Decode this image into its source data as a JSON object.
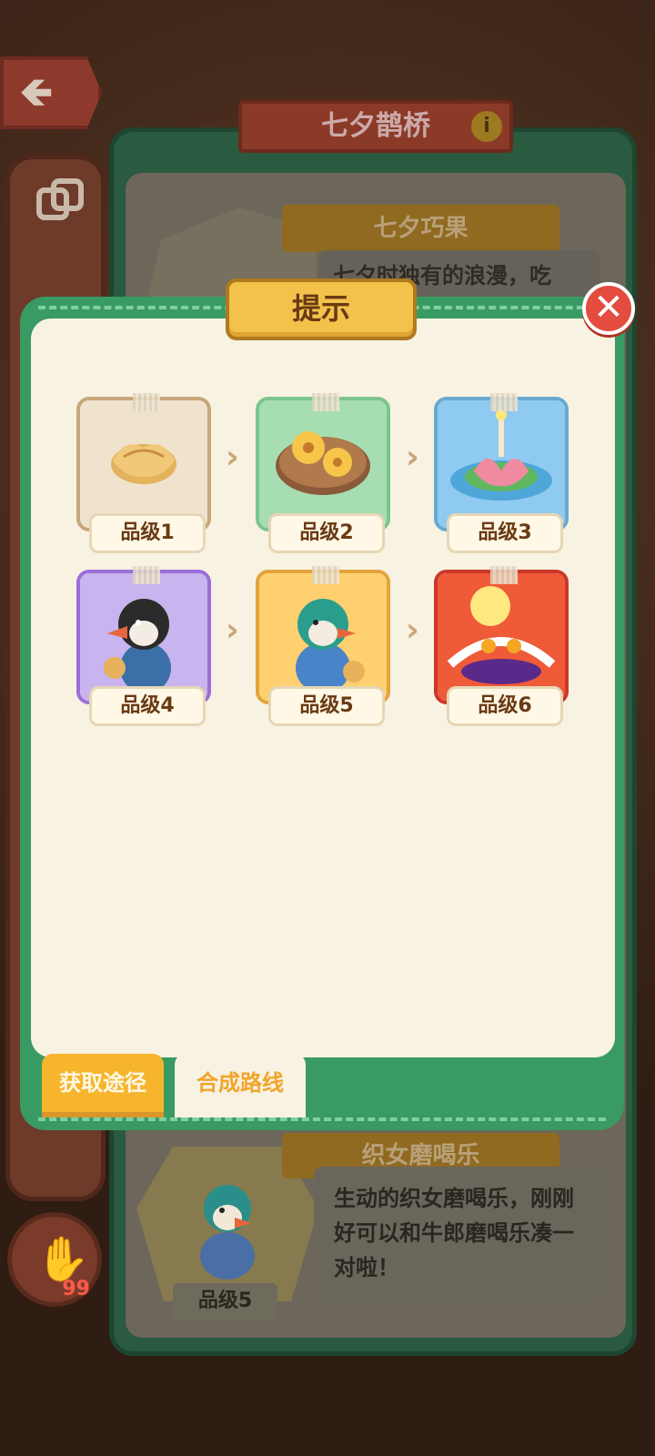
{
  "background": {
    "back_arrow": "🡸",
    "title": "七夕鹊桥",
    "info_icon": "i",
    "top_item_name": "七夕巧果",
    "top_item_desc": "七夕时独有的浪漫，吃",
    "bottom_item_name": "织女磨喝乐",
    "bottom_item_desc": "生动的织女磨喝乐，刚刚好可以和牛郎磨喝乐凑一对啦！",
    "bottom_item_grade": "品级5",
    "hand_count": "99"
  },
  "modal": {
    "title": "提示",
    "close_icon": "✕",
    "tiers": [
      {
        "label": "品级1",
        "bg": "#f0e3cd",
        "border": "#c6a67a"
      },
      {
        "label": "品级2",
        "bg": "#a6deb2",
        "border": "#7bc58e"
      },
      {
        "label": "品级3",
        "bg": "#8fcaf0",
        "border": "#6aa9cf"
      },
      {
        "label": "品级4",
        "bg": "#c8b4ee",
        "border": "#9a6fd8"
      },
      {
        "label": "品级5",
        "bg": "#ffd070",
        "border": "#e3a43a"
      },
      {
        "label": "品级6",
        "bg": "#ef5a38",
        "border": "#c9382a"
      }
    ],
    "chevron": "›",
    "tabs": {
      "get_label": "获取途径",
      "route_label": "合成路线"
    }
  }
}
